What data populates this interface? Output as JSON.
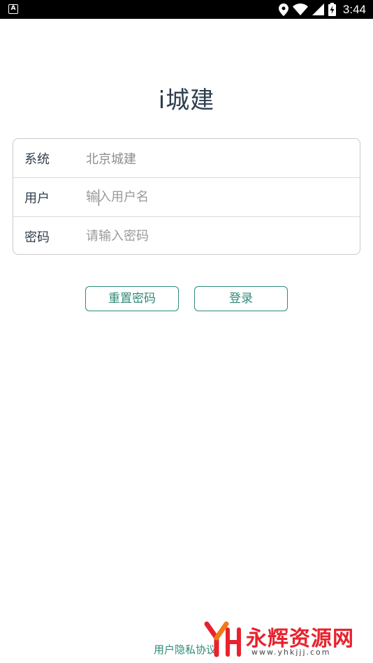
{
  "status_bar": {
    "left_icon": "A",
    "time": "3:44",
    "icons": [
      "location-icon",
      "wifi-icon",
      "signal-icon",
      "battery-charging-icon"
    ]
  },
  "app": {
    "title": "i城建"
  },
  "form": {
    "system": {
      "label": "系统",
      "value": "北京城建"
    },
    "user": {
      "label": "用户",
      "placeholder": "输入用户名",
      "value": ""
    },
    "password": {
      "label": "密码",
      "placeholder": "请输入密码",
      "value": ""
    }
  },
  "buttons": {
    "reset_password": "重置密码",
    "login": "登录"
  },
  "footer": {
    "privacy_link": "用户隐私协议"
  },
  "watermark": {
    "text": "永辉资源网",
    "url": "www.yhkjjj.com"
  },
  "colors": {
    "accent": "#2f8a7a",
    "title": "#2e3d4e",
    "watermark": "#e8222d"
  }
}
